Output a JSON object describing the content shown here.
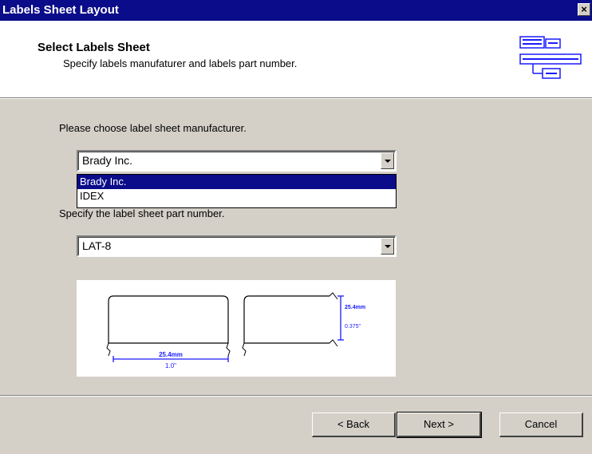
{
  "window": {
    "title": "Labels Sheet Layout",
    "close_glyph": "×"
  },
  "header": {
    "title": "Select Labels Sheet",
    "subtitle": "Specify labels manufaturer and labels part number.",
    "logo_icon": "label-sheet-icon"
  },
  "manufacturer": {
    "prompt": "Please choose label sheet manufacturer.",
    "selected": "Brady Inc.",
    "options": [
      "Brady Inc.",
      "IDEX"
    ],
    "highlighted_index": 0
  },
  "part_number": {
    "prompt": "Specify the label sheet part number.",
    "selected": "LAT-8"
  },
  "preview": {
    "width_mm": "25.4mm",
    "width_in": "1.0\"",
    "height_mm": "25.4mm",
    "height_in": "0.375\""
  },
  "buttons": {
    "back": "< Back",
    "next": "Next >",
    "cancel": "Cancel"
  },
  "colors": {
    "titlebar": "#0a0c8a",
    "dimension": "#1a1aff",
    "face": "#d4d0c8"
  }
}
